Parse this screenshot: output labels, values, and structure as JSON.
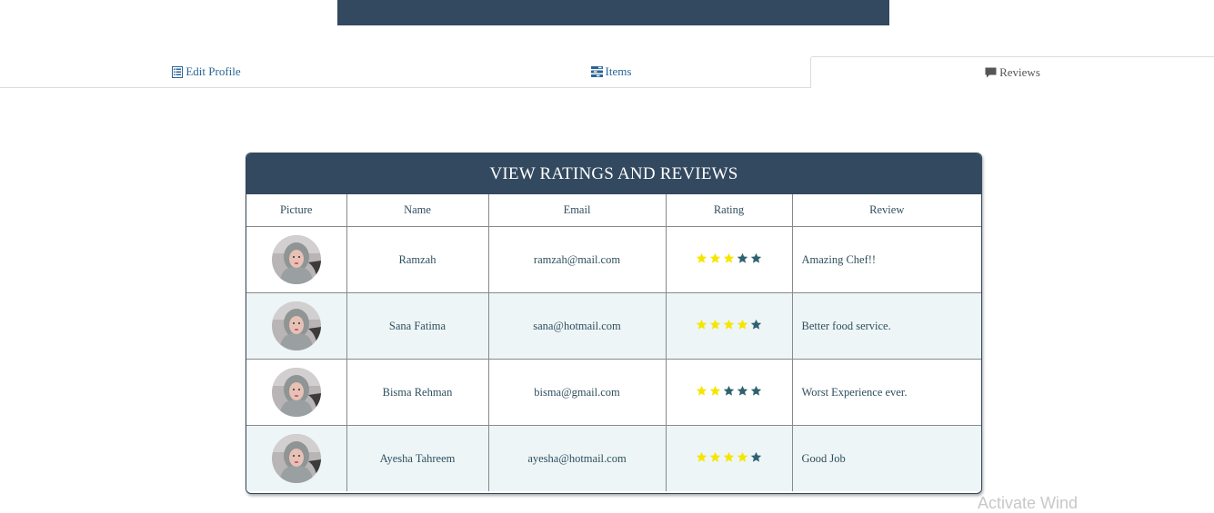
{
  "tabs": [
    {
      "label": "Edit Profile",
      "icon": "list-alt-icon"
    },
    {
      "label": "Items",
      "icon": "tasks-icon"
    },
    {
      "label": "Reviews",
      "icon": "comment-icon",
      "active": true
    }
  ],
  "panel": {
    "title": "VIEW RATINGS AND REVIEWS",
    "columns": [
      "Picture",
      "Name",
      "Email",
      "Rating",
      "Review"
    ],
    "rows": [
      {
        "name": "Ramzah",
        "email": "ramzah@mail.com",
        "rating": 3,
        "review": "Amazing Chef!!"
      },
      {
        "name": "Sana Fatima",
        "email": "sana@hotmail.com",
        "rating": 4,
        "review": "Better food service."
      },
      {
        "name": "Bisma Rehman",
        "email": "bisma@gmail.com",
        "rating": 2,
        "review": "Worst Experience ever."
      },
      {
        "name": "Ayesha Tahreem",
        "email": "ayesha@hotmail.com",
        "rating": 4,
        "review": "Good Job"
      }
    ],
    "max_rating": 5
  },
  "watermark": "Activate Wind",
  "colors": {
    "header_bg": "#33495f",
    "star_filled": "#f5e600",
    "star_empty": "#2f6270",
    "alt_row": "#edf5f6",
    "link": "#2a6496"
  }
}
